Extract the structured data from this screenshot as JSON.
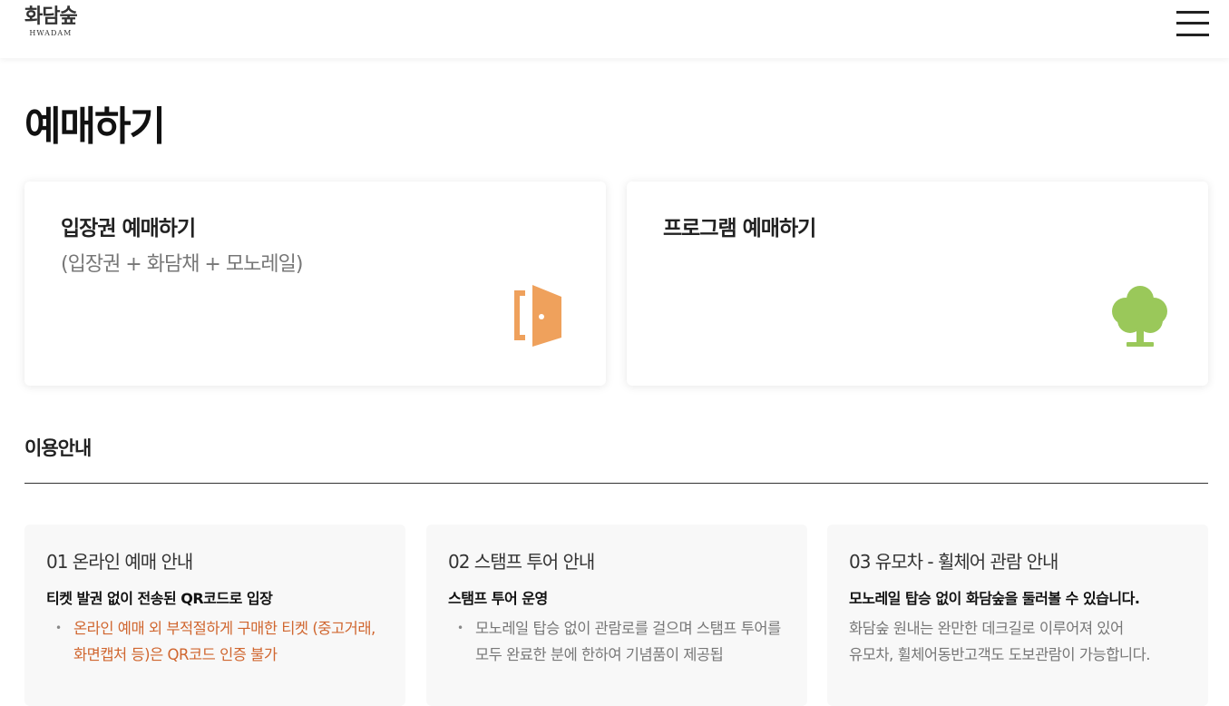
{
  "header": {
    "logo_ko": "화담숲",
    "logo_en": "HWADAM",
    "menu_icon": "hamburger-menu-icon"
  },
  "page": {
    "title": "예매하기"
  },
  "booking_cards": [
    {
      "title": "입장권 예매하기",
      "subtitle": "(입장권 + 화담채 + 모노레일)",
      "icon": "door-icon",
      "icon_color": "#EFA15C"
    },
    {
      "title": "프로그램 예매하기",
      "icon": "tree-icon",
      "icon_color": "#9AC85A"
    }
  ],
  "usage": {
    "title": "이용안내",
    "cards": [
      {
        "title": "01 온라인 예매 안내",
        "heading": "티켓 발권 없이 전송된 QR코드로 입장",
        "lines": [
          "온라인 예매 외 부적절하게 구매한 티켓 (중고거래, 화면캡처 등)은 QR코드 인증 불가"
        ]
      },
      {
        "title": "02 스탬프 투어 안내",
        "heading": "스탬프 투어 운영",
        "lines": [
          "모노레일 탑승 없이 관람로를 걸으며 스탬프 투어를 모두 완료한 분에 한하여 기념품이 제공됩"
        ]
      },
      {
        "title": "03 유모차 - 휠체어 관람 안내",
        "heading": "모노레일 탑승 없이 화담숲을 둘러볼 수 있습니다.",
        "body_lines": [
          "화담숲 원내는 완만한 데크길로 이루어져 있어",
          "유모차, 휠체어동반고객도 도보관람이 가능합니다."
        ]
      }
    ]
  },
  "colors": {
    "accent_warning": "#D0662F",
    "door": "#EFA15C",
    "tree": "#9AC85A"
  }
}
